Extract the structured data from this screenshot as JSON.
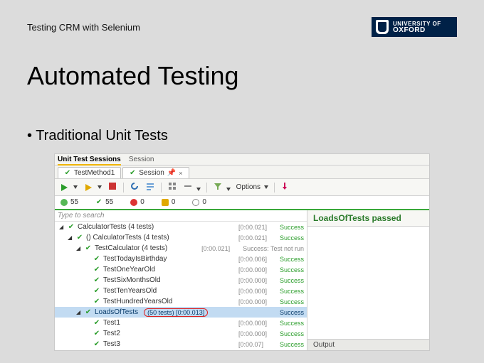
{
  "header": {
    "crumb": "Testing CRM with Selenium",
    "logo_line1": "UNIVERSITY OF",
    "logo_line2": "OXFORD"
  },
  "title": "Automated Testing",
  "bullet": "• Traditional Unit Tests",
  "sessions_bar": {
    "label1": "Unit Test Sessions",
    "label2": "Session"
  },
  "tabs": {
    "method": "TestMethod1",
    "session": "Session",
    "pin": "📌",
    "close": "×"
  },
  "toolbar": {
    "options": "Options"
  },
  "counts": {
    "pass1": "55",
    "pass2": "55",
    "fail": "0",
    "warn": "0",
    "skip": "0"
  },
  "search_placeholder": "Type to search",
  "tree": [
    {
      "indent": 0,
      "tri": "◢",
      "tick": true,
      "name": "CalculatorTests",
      "suffix": "(4 tests)",
      "time": "[0:00.021]",
      "status": "Success"
    },
    {
      "indent": 1,
      "tri": "◢",
      "tick": true,
      "name": "()  CalculatorTests",
      "suffix": "(4 tests)",
      "time": "[0:00.021]",
      "status": "Success"
    },
    {
      "indent": 2,
      "tri": "◢",
      "tick": true,
      "name": "TestCalculator",
      "suffix": "(4 tests)",
      "time": "[0:00.021]",
      "status": "Success: Test not run",
      "statusClass": "grey"
    },
    {
      "indent": 3,
      "tri": "",
      "tick": true,
      "name": "TestTodayIsBirthday",
      "suffix": "",
      "time": "[0:00.006]",
      "status": "Success"
    },
    {
      "indent": 3,
      "tri": "",
      "tick": true,
      "name": "TestOneYearOld",
      "suffix": "",
      "time": "[0:00.000]",
      "status": "Success"
    },
    {
      "indent": 3,
      "tri": "",
      "tick": true,
      "name": "TestSixMonthsOld",
      "suffix": "",
      "time": "[0:00.000]",
      "status": "Success"
    },
    {
      "indent": 3,
      "tri": "",
      "tick": true,
      "name": "TestTenYearsOld",
      "suffix": "",
      "time": "[0:00.000]",
      "status": "Success"
    },
    {
      "indent": 3,
      "tri": "",
      "tick": true,
      "name": "TestHundredYearsOld",
      "suffix": "",
      "time": "[0:00.000]",
      "status": "Success"
    },
    {
      "indent": 2,
      "tri": "◢",
      "tick": true,
      "name": "LoadsOfTests",
      "suffix": "(50 tests)",
      "time": "[0:00.013]",
      "status": "Success",
      "selected": true,
      "redbox": true
    },
    {
      "indent": 3,
      "tri": "",
      "tick": true,
      "name": "Test1",
      "suffix": "",
      "time": "[0:00.000]",
      "status": "Success"
    },
    {
      "indent": 3,
      "tri": "",
      "tick": true,
      "name": "Test2",
      "suffix": "",
      "time": "[0:00.000]",
      "status": "Success"
    },
    {
      "indent": 3,
      "tri": "",
      "tick": true,
      "name": "Test3",
      "suffix": "",
      "time": "[0:00.07]",
      "status": "Success"
    }
  ],
  "right": {
    "passed_label": "LoadsOfTests passed",
    "output_tab": "Output"
  }
}
